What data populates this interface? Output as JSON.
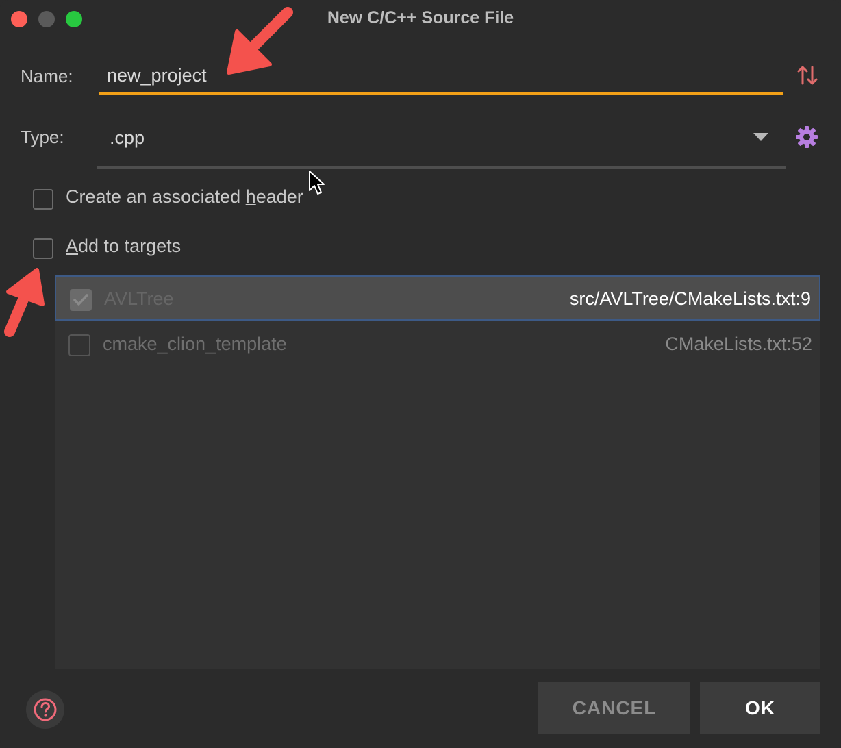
{
  "window": {
    "title": "New C/C++ Source File"
  },
  "name_field": {
    "label": "Name:",
    "value": "new_project"
  },
  "type_field": {
    "label": "Type:",
    "value": ".cpp"
  },
  "options": {
    "create_header": {
      "label_before": "Create an associated ",
      "label_mnemonic": "h",
      "label_after": "eader",
      "checked": false
    },
    "add_to_targets": {
      "label_mnemonic": "A",
      "label_after": "dd to targets",
      "checked": false
    }
  },
  "targets": [
    {
      "name": "AVLTree",
      "path": "src/AVLTree/CMakeLists.txt:9",
      "checked": true,
      "selected": true
    },
    {
      "name": "cmake_clion_template",
      "path": "CMakeLists.txt:52",
      "checked": false,
      "selected": false
    }
  ],
  "buttons": {
    "cancel": "CANCEL",
    "ok": "OK"
  },
  "icons": {
    "sort": "sort-arrows-icon",
    "settings": "gear-icon",
    "help": "help-icon",
    "dropdown": "chevron-down-icon"
  },
  "colors": {
    "accent_underline": "#f2a017",
    "annotation_arrow": "#f4524d",
    "gear": "#b77ee0",
    "sort": "#e06c6c",
    "help": "#f06a7a"
  }
}
